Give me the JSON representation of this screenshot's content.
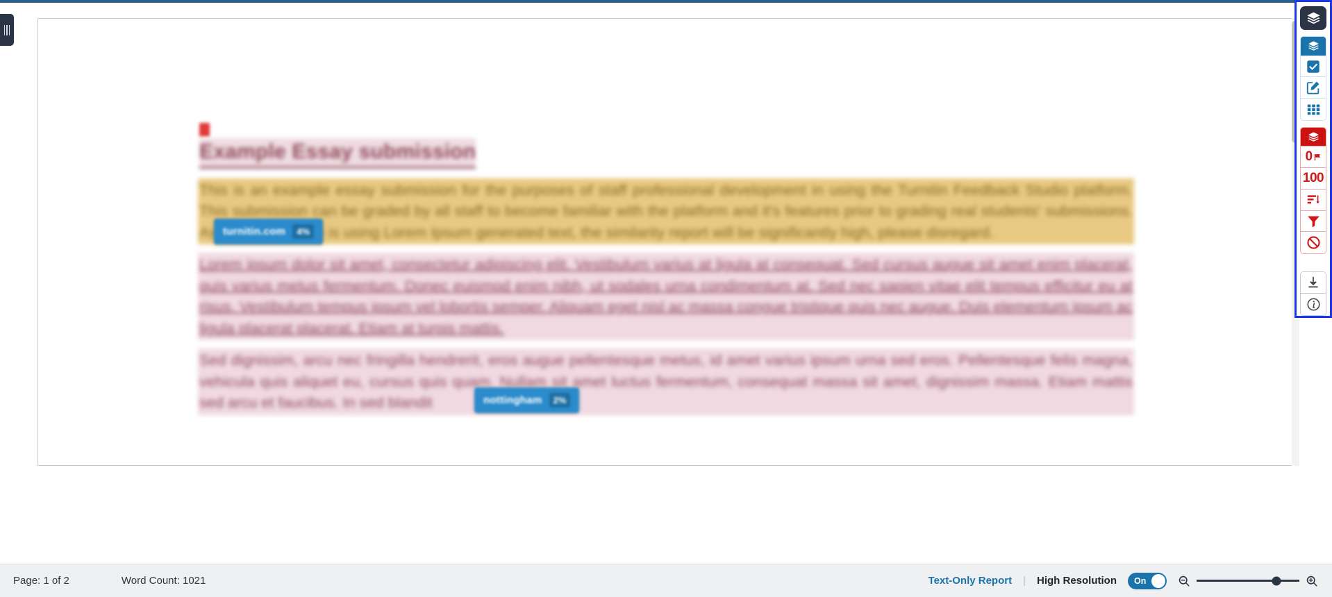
{
  "app": {
    "accent_color": "#2b5f85",
    "highlight_border_color": "#1a37e8",
    "link_color": "#1a74ab"
  },
  "left_panel_handle": {
    "name": "sources-panel-toggle",
    "icon": "grip-handle-icon"
  },
  "document": {
    "title": "Example Essay submission",
    "flag_marker": "red-flag-marker",
    "paragraphs": [
      {
        "highlight": "gold",
        "text": "This is an example essay submission for the purposes of staff professional development in using the Turnitin Feedback Studio platform. This submission can be graded by all staff to become familiar with the platform and it's features prior to grading real students' submissions. As this submission is using Lorem Ipsum generated text, the similarity report will be significantly high, please disregard."
      },
      {
        "highlight": "pink-gold",
        "text": "Lorem ipsum dolor sit amet, consectetur adipiscing elit. Vestibulum varius at ligula at consequat. Sed cursus augue sit amet enim placerat, quis varius metus fermentum. Donec euismod enim nibh, ut sodales urna condimentum at. Sed nec sapien vitae elit tempus efficitur eu at risus. Vestibulum tempus ipsum vel lobortis semper. Aliquam eget nisl ac massa congue tristique quis nec augue. Duis elementum ipsum ac ligula placerat placerat. Etiam at turpis mattis."
      },
      {
        "highlight": "pink",
        "text": "Sed dignissim, arcu nec fringilla hendrerit, eros augue pellentesque metus, id amet varius ipsum urna sed eros. Pellentesque felis magna, vehicula quis aliquet eu, cursus quis quam. Nullam sit amet luctus fermentum, consequat massa sit amet, dignissim massa. Etiam mattis sed arcu et faucibus. In sed blandit"
      }
    ],
    "match_badges": [
      {
        "source": "turnitin.com",
        "percent": "4%",
        "name": "match-badge-1"
      },
      {
        "source": "nottingham",
        "percent": "2%",
        "name": "match-badge-2"
      }
    ]
  },
  "sidebar": {
    "main_toggle": {
      "label": "layers-stack-icon",
      "active": true
    },
    "blue_group": [
      {
        "name": "similarity-layers-icon",
        "icon": "layers",
        "active": true
      },
      {
        "name": "grademark-check-icon",
        "icon": "checkbox"
      },
      {
        "name": "feedback-edit-icon",
        "icon": "pencil-square"
      },
      {
        "name": "rubric-grid-icon",
        "icon": "grid"
      }
    ],
    "red_group": [
      {
        "name": "similarity-layer-toggle",
        "icon": "layers",
        "active": true
      },
      {
        "name": "flagged-count",
        "value": "0",
        "icon": "flag"
      },
      {
        "name": "similarity-score",
        "value": "100"
      },
      {
        "name": "sort-sources-icon",
        "icon": "sort-descending"
      },
      {
        "name": "filter-sources-icon",
        "icon": "funnel"
      },
      {
        "name": "excluded-sources-icon",
        "icon": "block"
      }
    ],
    "bottom_group": [
      {
        "name": "download-icon",
        "icon": "download"
      },
      {
        "name": "submission-info-icon",
        "icon": "info-circle"
      }
    ]
  },
  "statusbar": {
    "page": "Page: 1 of 2",
    "word_count": "Word Count: 1021",
    "text_only_report": "Text-Only Report",
    "divider": "|",
    "high_resolution_label": "High Resolution",
    "toggle_state": "On",
    "zoom_out_icon": "zoom-out-icon",
    "zoom_in_icon": "zoom-in-icon",
    "zoom_value": "78"
  }
}
